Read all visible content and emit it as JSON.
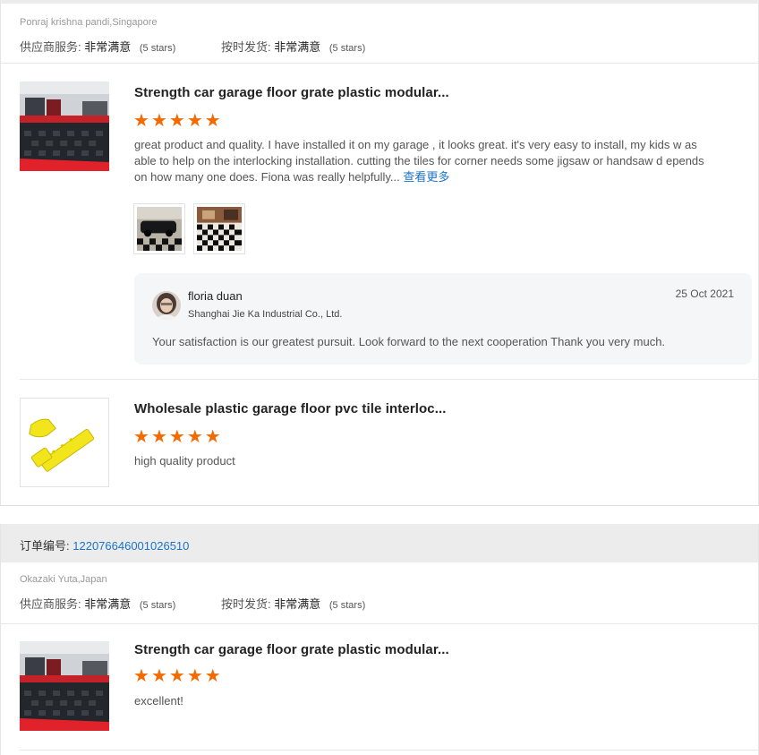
{
  "rating_labels": {
    "supplier_service": "供应商服务:",
    "on_time_shipment": "按时发货:",
    "value": "非常满意",
    "stars_note": "(5 stars)"
  },
  "review1": {
    "buyer": "Ponraj krishna pandi,Singapore",
    "products": [
      {
        "title": "Strength car garage floor grate plastic modular...",
        "stars": 5,
        "text": "great product and quality. I have installed it on my garage , it looks great.  it's very easy to install, my kids w as able to help on the interlocking installation. cutting the tiles for corner needs some jigsaw or handsaw d epends on how many one does. Fiona was really helpfully...",
        "more_label": "查看更多",
        "reply": {
          "name": "floria duan",
          "company": "Shanghai Jie Ka Industrial Co., Ltd.",
          "date": "25 Oct 2021",
          "message": "Your satisfaction is our greatest pursuit. Look forward to the next cooperation Thank you very much."
        }
      },
      {
        "title": "Wholesale plastic garage floor pvc tile interloc...",
        "stars": 5,
        "text": "high quality product"
      }
    ]
  },
  "review2": {
    "order_label": "订单编号:",
    "order_number": "122076646001026510",
    "buyer": "Okazaki Yuta,Japan",
    "products": [
      {
        "title": "Strength car garage floor grate plastic modular...",
        "stars": 5,
        "text": "excellent!"
      }
    ]
  },
  "colors": {
    "star": "#f56a00",
    "link": "#1a73c8",
    "tile_red": "#e2222a",
    "tile_dark": "#2a2d33",
    "tile_yellow": "#f2e51c"
  },
  "icons": [
    "star-icon",
    "avatar"
  ]
}
